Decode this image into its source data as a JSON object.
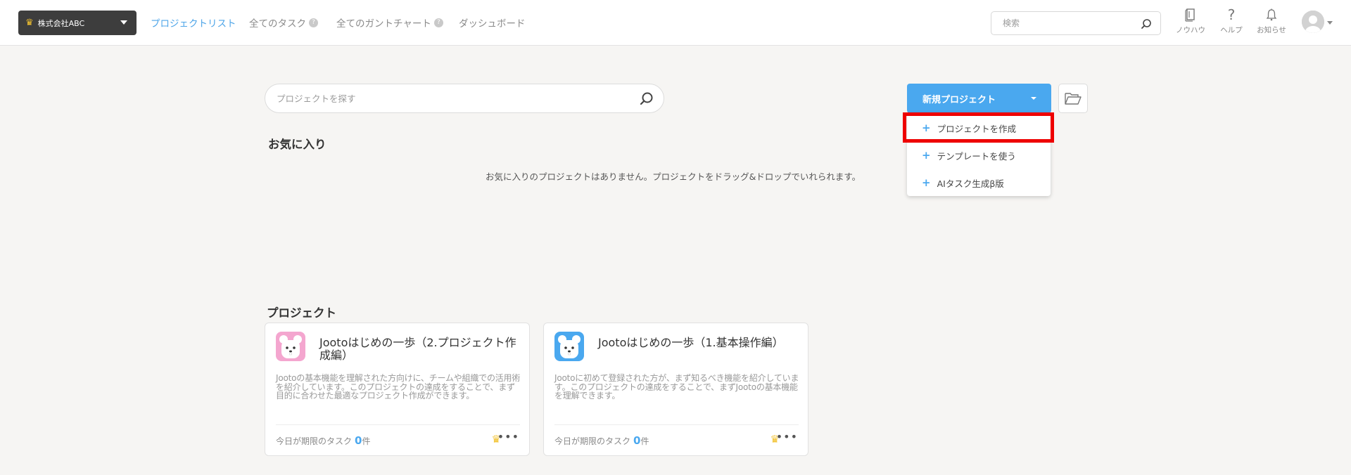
{
  "header": {
    "org_name": "株式会社ABC",
    "nav": [
      {
        "label": "プロジェクトリスト",
        "active": true
      },
      {
        "label": "全てのタスク",
        "help": "?"
      },
      {
        "label": "全てのガントチャート",
        "help": "?"
      },
      {
        "label": "ダッシュボード"
      }
    ],
    "search_placeholder": "検索",
    "icons": [
      {
        "label": "ノウハウ",
        "icon": "book-icon"
      },
      {
        "label": "ヘルプ",
        "icon": "question-icon"
      },
      {
        "label": "お知らせ",
        "icon": "bell-icon"
      }
    ]
  },
  "main": {
    "project_search_placeholder": "プロジェクトを探す",
    "new_project_label": "新規プロジェクト",
    "dropdown": [
      {
        "label": "プロジェクトを作成"
      },
      {
        "label": "テンプレートを使う"
      },
      {
        "label": "AIタスク生成β版"
      }
    ],
    "favorites_title": "お気に入り",
    "favorites_empty": "お気に入りのプロジェクトはありません。プロジェクトをドラッグ&ドロップでいれられます。",
    "projects_title": "プロジェクト",
    "projects": [
      {
        "title": "Jootoはじめの一歩（2.プロジェクト作成編）",
        "description": "Jootoの基本機能を理解された方向けに、チームや組織での活用術を紹介しています。このプロジェクトの達成をすることで、まず目的に合わせた最適なプロジェクト作成ができます。",
        "due_label": "今日が期限のタスク",
        "due_count": "0",
        "due_unit": "件",
        "icon_color": "#f4a6cf"
      },
      {
        "title": "Jootoはじめの一歩（1.基本操作編）",
        "description": "Jootoに初めて登録された方が、まず知るべき機能を紹介しています。このプロジェクトの達成をすることで、まずJootoの基本機能を理解できます。",
        "due_label": "今日が期限のタスク",
        "due_count": "0",
        "due_unit": "件",
        "icon_color": "#4aa8ef"
      }
    ]
  },
  "colors": {
    "accent": "#4aa8ef",
    "highlight": "#ee0000",
    "crown": "#f2c230"
  }
}
